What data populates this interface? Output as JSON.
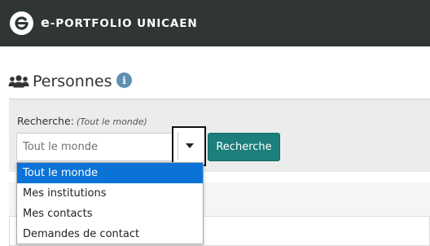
{
  "header": {
    "logo_icon": "eportfolio-e-logo-icon",
    "brand_prefix": "e",
    "brand_rest": "-PORTFOLIO UNICAEN",
    "background_color": "#303536"
  },
  "page": {
    "title_icon": "people-icon",
    "title": "Personnes",
    "info_icon": "info-icon",
    "info_glyph": "i"
  },
  "search": {
    "label": "Recherche:",
    "hint": "(Tout le monde)",
    "select_value": "Tout le monde",
    "toggle_icon": "chevron-down-icon",
    "button_label": "Recherche",
    "button_color": "#1c7f7b"
  },
  "dropdown": {
    "selected_color": "#0b73d8",
    "options": [
      {
        "label": "Tout le monde",
        "selected": true
      },
      {
        "label": "Mes institutions",
        "selected": false
      },
      {
        "label": "Mes contacts",
        "selected": false
      },
      {
        "label": "Demandes de contact",
        "selected": false
      }
    ]
  }
}
